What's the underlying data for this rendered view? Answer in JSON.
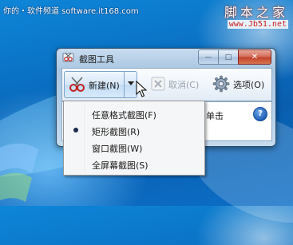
{
  "watermark": {
    "top_text": "你的・软件频道 software.it168.com",
    "brand": "脚本之家",
    "url": "www.Jb51.net"
  },
  "window": {
    "title": "截图工具",
    "controls": {
      "minimize": "—",
      "maximize": "□",
      "close": "✕"
    }
  },
  "toolbar": {
    "new_label": "新建(N)",
    "cancel_label": "取消(C)",
    "options_label": "选项(O)"
  },
  "content": {
    "hint": "单击",
    "help_symbol": "?"
  },
  "menu": {
    "items": [
      {
        "label": "任意格式截图(F)",
        "selected": false
      },
      {
        "label": "矩形截图(R)",
        "selected": true
      },
      {
        "label": "窗口截图(W)",
        "selected": false
      },
      {
        "label": "全屏幕截图(S)",
        "selected": false
      }
    ]
  },
  "colors": {
    "desktop": "#0a6fc2",
    "close_button": "#c0412a",
    "help_icon": "#1f5fb8"
  },
  "icons": {
    "app": "snipping-tool-icon",
    "new": "scissors-icon",
    "cancel": "cancel-x-icon",
    "options": "gear-icon",
    "help": "help-icon"
  }
}
